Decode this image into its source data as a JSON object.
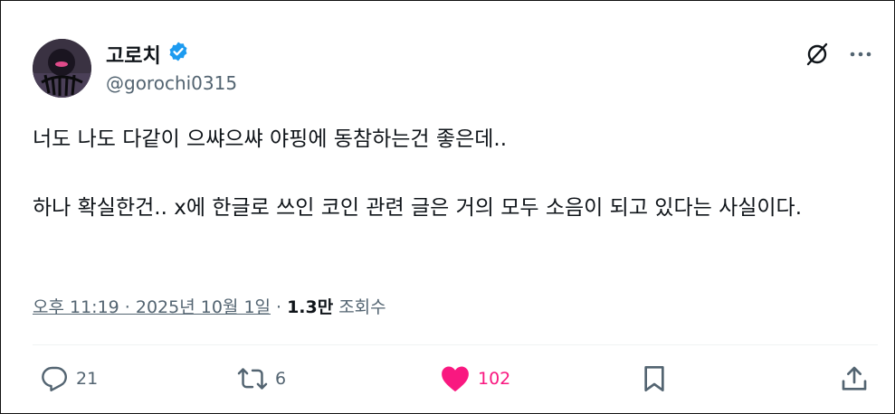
{
  "author": {
    "display_name": "고로치",
    "handle": "@gorochi0315",
    "verified_badge_color": "#1d9bf0"
  },
  "header_icons": [
    "grok-icon",
    "more-icon"
  ],
  "tweet": {
    "text": "너도 나도 다같이 으쌰으쌰 야핑에 동참하는건 좋은데..\n\n하나 확실한건.. x에 한글로 쓰인 코인 관련 글은 거의 모두 소음이 되고 있다는 사실이다."
  },
  "meta": {
    "time": "오후 11:19 · 2025년 10월 1일",
    "separator": "·",
    "views_count": "1.3만",
    "views_label": "조회수"
  },
  "actions": {
    "reply_count": "21",
    "repost_count": "6",
    "like_count": "102",
    "like_color": "#f91880"
  }
}
